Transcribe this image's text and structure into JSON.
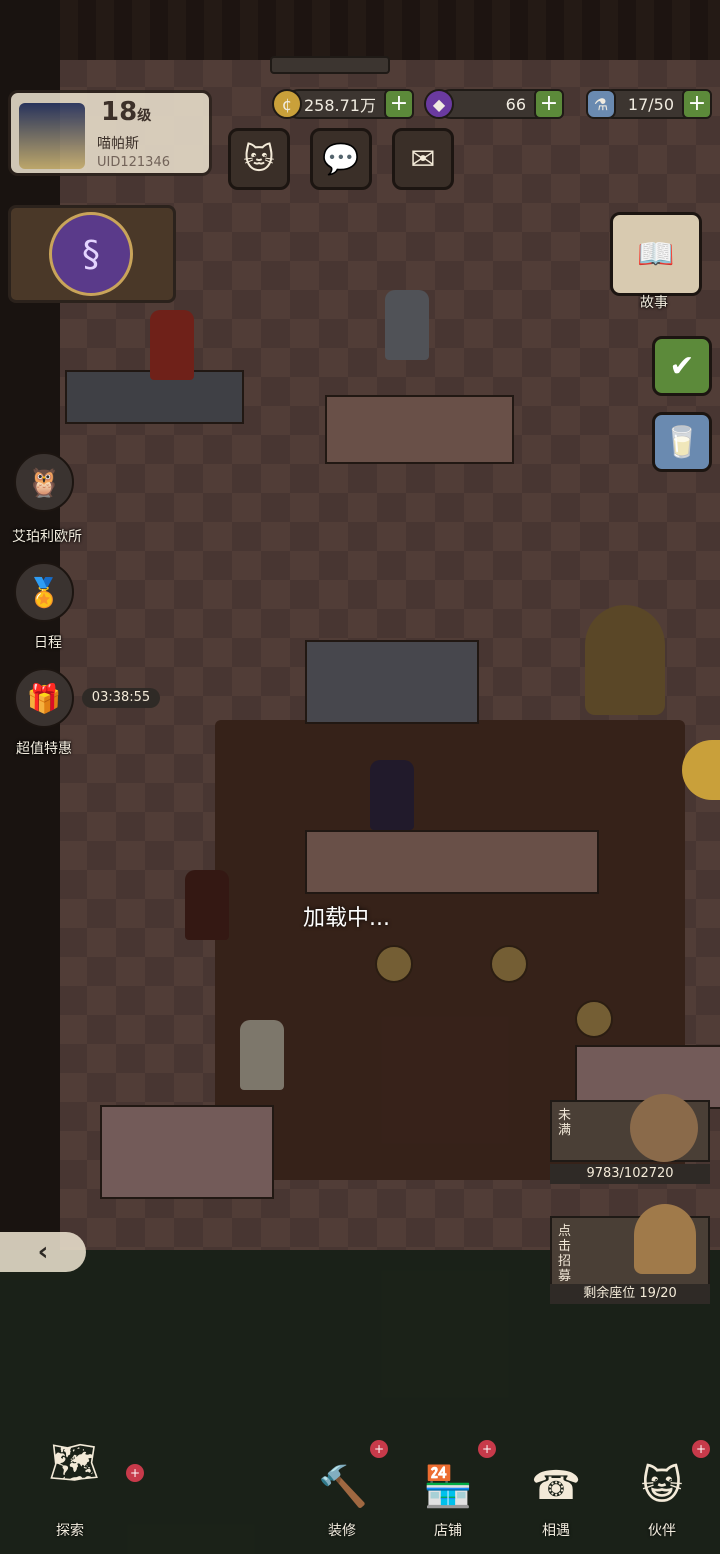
{
  "player": {
    "level": "18",
    "level_unit": "级",
    "name": "喵帕斯",
    "uid": "UID121346"
  },
  "resources": {
    "gold": "258.71万",
    "gems": "66",
    "stamina": "17/50"
  },
  "side_menu": {
    "agency_label": "艾珀利欧所",
    "schedule_label": "日程",
    "deal_label": "超值特惠",
    "deal_timer": "03:38:55"
  },
  "right_menu": {
    "story_label": "故事"
  },
  "loading_text": "加载中...",
  "shop_panel": {
    "status_label": "未满",
    "progress_text": "9783/102720",
    "recruit_label": "点击招募",
    "seats_text": "剩余座位 19/20"
  },
  "bottom_nav": {
    "explore": "探索",
    "decorate": "装修",
    "shop": "店铺",
    "encounter": "相遇",
    "partner": "伙伴"
  },
  "colors": {
    "accent_green": "#5c8a3a",
    "badge_red": "#c73a4a",
    "panel_dark": "#3c3530"
  }
}
